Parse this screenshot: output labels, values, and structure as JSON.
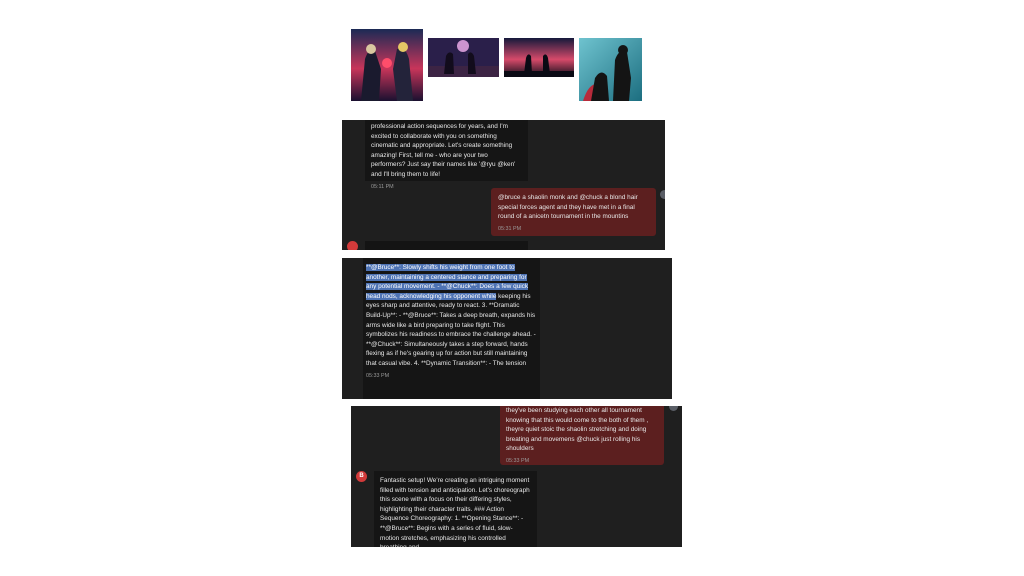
{
  "thumbnails": [
    {
      "name": "thumb-fighters-face-off",
      "colors": [
        "#1b2a55",
        "#c8355a"
      ]
    },
    {
      "name": "thumb-fighters-spotlight",
      "colors": [
        "#2a1f4a",
        "#a14a8a"
      ]
    },
    {
      "name": "thumb-silhouettes-sunset",
      "colors": [
        "#14193b",
        "#d64a6a"
      ]
    },
    {
      "name": "thumb-fighters-teal",
      "colors": [
        "#1c6e80",
        "#b82b3b"
      ]
    }
  ],
  "panel1": {
    "bot_message": "professional action sequences for years, and I'm excited to collaborate with you on something cinematic and appropriate. Let's create something amazing! First, tell me - who are your two performers? Just say their names like '@ryu @ken' and I'll bring them to life!",
    "bot_time": "05:11 PM",
    "user_message": "@bruce a shaolin monk and @chuck a blond hair special forces agent and they have met in a final round of a anicetn tournament in the mountins",
    "user_time": "05:31 PM"
  },
  "panel2": {
    "highlighted": "**@Bruce**: Slowly shifts his weight from one foot to another, maintaining a centered stance and preparing for any potential movement. - **@Chuck**: Does a few quick head nods, acknowledging his opponent while",
    "rest": " keeping his eyes sharp and attentive, ready to react. 3. **Dramatic Build-Up**: - **@Bruce**: Takes a deep breath, expands his arms wide like a bird preparing to take flight. This symbolizes his readiness to embrace the challenge ahead. - **@Chuck**: Simultaneously takes a step forward, hands flexing as if he's gearing up for action but still maintaining that casual vibe. 4. **Dynamic Transition**: - The tension",
    "time": "05:33 PM"
  },
  "panel3": {
    "user_message": "they've been studying each other all tournament knowing that this would come to the both of them , theyre quiet stoic the shaolin stretching and doing breating and movemens @chuck just rolling his shoulders",
    "user_time": "05:33 PM",
    "avatar_letter": "B",
    "bot_message": "Fantastic setup! We're creating an intriguing moment filled with tension and anticipation. Let's choreograph this scene with a focus on their differing styles, highlighting their character traits. ### Action Sequence Choreography: 1. **Opening Stance**: - **@Bruce**: Begins with a series of fluid, slow-motion stretches, emphasizing his controlled breathing and"
  }
}
